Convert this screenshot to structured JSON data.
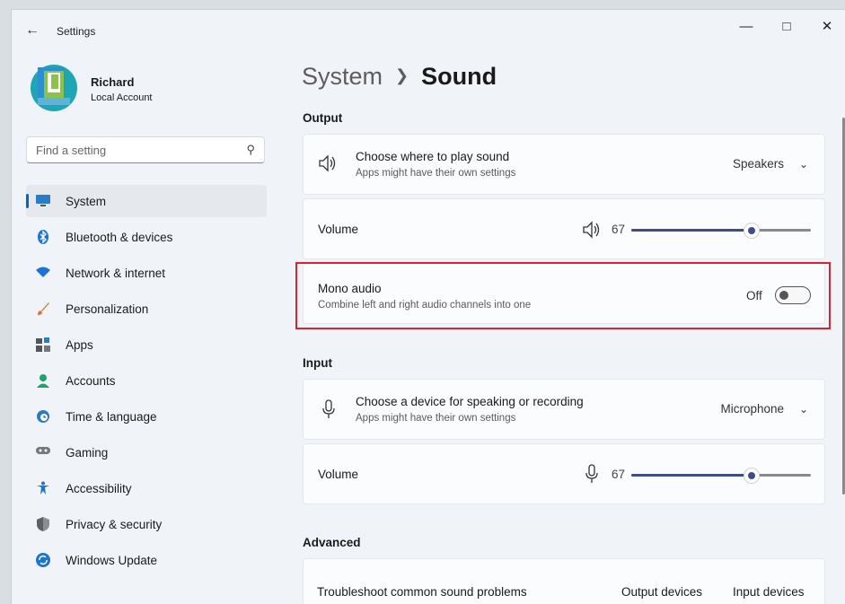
{
  "window": {
    "title": "Settings"
  },
  "profile": {
    "name": "Richard",
    "account_type": "Local Account"
  },
  "search": {
    "placeholder": "Find a setting"
  },
  "nav": [
    {
      "label": "System",
      "icon": "monitor-icon",
      "active": true
    },
    {
      "label": "Bluetooth & devices",
      "icon": "bluetooth-icon"
    },
    {
      "label": "Network & internet",
      "icon": "wifi-icon"
    },
    {
      "label": "Personalization",
      "icon": "brush-icon"
    },
    {
      "label": "Apps",
      "icon": "apps-icon"
    },
    {
      "label": "Accounts",
      "icon": "person-icon"
    },
    {
      "label": "Time & language",
      "icon": "clock-globe-icon"
    },
    {
      "label": "Gaming",
      "icon": "gamepad-icon"
    },
    {
      "label": "Accessibility",
      "icon": "accessibility-icon"
    },
    {
      "label": "Privacy & security",
      "icon": "shield-icon"
    },
    {
      "label": "Windows Update",
      "icon": "update-icon"
    }
  ],
  "breadcrumb": {
    "parent": "System",
    "current": "Sound"
  },
  "output": {
    "heading": "Output",
    "device": {
      "title": "Choose where to play sound",
      "subtitle": "Apps might have their own settings",
      "value": "Speakers"
    },
    "volume": {
      "label": "Volume",
      "value": "67",
      "fraction": 0.67
    },
    "mono": {
      "title": "Mono audio",
      "subtitle": "Combine left and right audio channels into one",
      "state": "Off"
    }
  },
  "input": {
    "heading": "Input",
    "device": {
      "title": "Choose a device for speaking or recording",
      "subtitle": "Apps might have their own settings",
      "value": "Microphone"
    },
    "volume": {
      "label": "Volume",
      "value": "67",
      "fraction": 0.67
    }
  },
  "advanced": {
    "heading": "Advanced",
    "troubleshoot": {
      "title": "Troubleshoot common sound problems",
      "link1": "Output devices",
      "link2": "Input devices"
    }
  },
  "colors": {
    "accent": "#0067c0",
    "slider": "#3b4d8f",
    "highlight": "#d9232e"
  }
}
